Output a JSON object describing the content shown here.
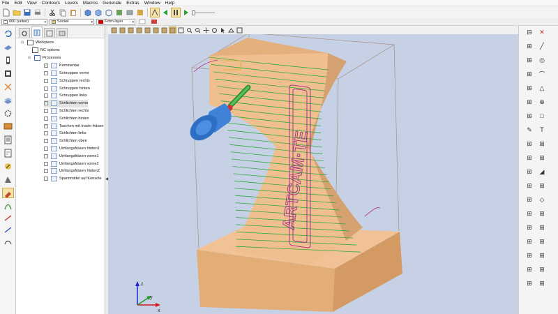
{
  "menu": [
    "File",
    "Edit",
    "View",
    "Contours",
    "Levels",
    "Macros",
    "Generate",
    "Extras",
    "Window",
    "Help"
  ],
  "toolbar2": {
    "layer_value": "000 (unten)",
    "group_value": "Sockel",
    "color_value": "From layer"
  },
  "tree": {
    "workpiece": "Workpiece",
    "nc_options": "NC options",
    "processes": "Processes",
    "items": [
      {
        "label": "Kommentar",
        "checked": true
      },
      {
        "label": "Schruppen vorne",
        "checked": false
      },
      {
        "label": "Schruppen rechts",
        "checked": false
      },
      {
        "label": "Schruppen hinten",
        "checked": false
      },
      {
        "label": "Schruppen links",
        "checked": false
      },
      {
        "label": "Schlichten vorne",
        "checked": true
      },
      {
        "label": "Schlichten rechts",
        "checked": false
      },
      {
        "label": "Schlichten hinten",
        "checked": false
      },
      {
        "label": "Taschen mit Inseln fräsen",
        "checked": true
      },
      {
        "label": "Schlichten links",
        "checked": false
      },
      {
        "label": "Schlichten oben",
        "checked": false
      },
      {
        "label": "Umfangsfräsen hinten1",
        "checked": false
      },
      {
        "label": "Umfangsfräsen vorne1",
        "checked": false
      },
      {
        "label": "Umfangsfräsen vorne2",
        "checked": false
      },
      {
        "label": "Umfangsfräsen hinten2",
        "checked": false
      },
      {
        "label": "Spannmittel auf Konsole",
        "checked": false
      }
    ]
  },
  "axes": {
    "x": "x",
    "y": "y",
    "z": "z"
  },
  "engraving": "ARTCAM·TE",
  "colors": {
    "toolpath": "#2faa3c",
    "contour": "#b0308a",
    "stock": "#e9b98a",
    "tool": "#2f70c8",
    "background": "#c7d1e6"
  }
}
